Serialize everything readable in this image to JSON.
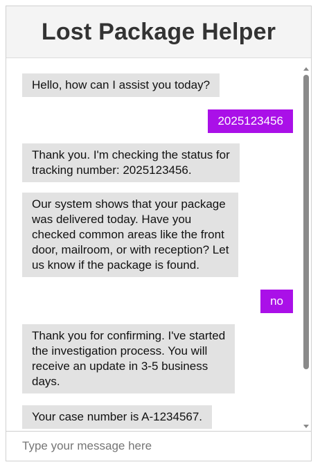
{
  "header": {
    "title": "Lost Package Helper"
  },
  "messages": [
    {
      "role": "bot",
      "text": "Hello, how can I assist you today?"
    },
    {
      "role": "user",
      "text": "2025123456"
    },
    {
      "role": "bot",
      "text": "Thank you. I'm checking the status for\ntracking number: 2025123456."
    },
    {
      "role": "bot",
      "text": "Our system shows that your package\nwas delivered today. Have you\nchecked common areas like the front\ndoor, mailroom, or with reception? Let\nus know if the package is found."
    },
    {
      "role": "user",
      "text": "no"
    },
    {
      "role": "bot",
      "text": "Thank you for confirming. I've started\nthe investigation process. You will\nreceive an update in 3-5 business\ndays."
    },
    {
      "role": "bot",
      "text": "Your case number is A-1234567."
    }
  ],
  "input": {
    "placeholder": "Type your message here",
    "value": ""
  },
  "colors": {
    "user_bubble": "#aa10e8",
    "bot_bubble": "#e2e2e2",
    "header_bg": "#f4f4f4"
  }
}
